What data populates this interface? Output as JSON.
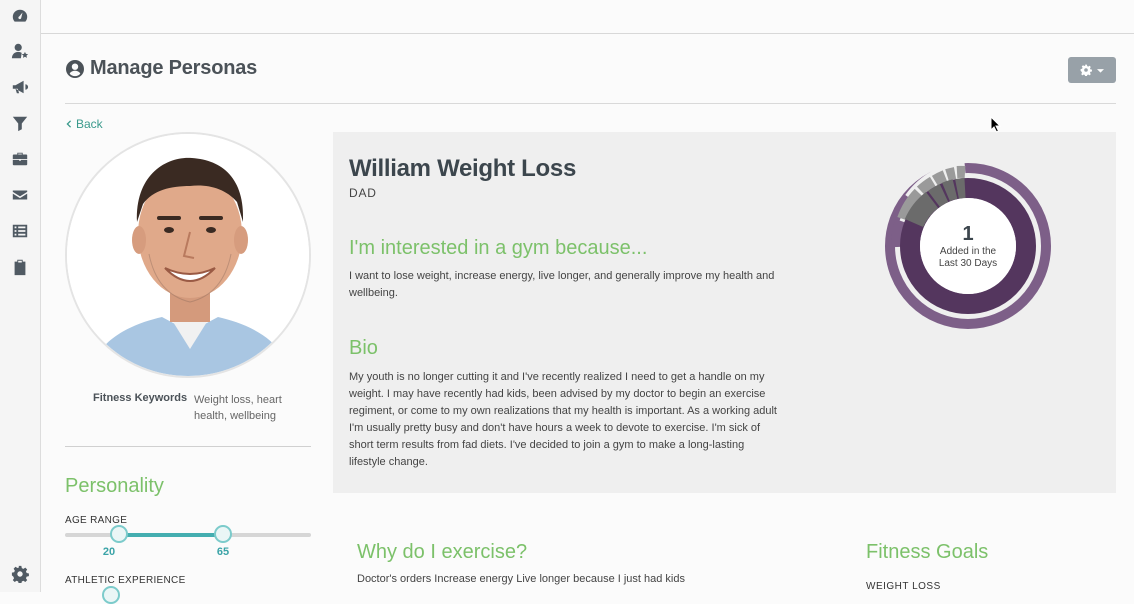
{
  "sidebar": {
    "items": [
      {
        "icon": "dashboard-icon"
      },
      {
        "icon": "user-star-icon"
      },
      {
        "icon": "megaphone-icon"
      },
      {
        "icon": "filter-icon"
      },
      {
        "icon": "briefcase-icon"
      },
      {
        "icon": "envelope-icon"
      },
      {
        "icon": "list-icon"
      },
      {
        "icon": "clipboard-icon"
      },
      {
        "icon": "gear-icon"
      }
    ]
  },
  "header": {
    "title": "Manage Personas",
    "icon": "user-circle-icon"
  },
  "back_label": "Back",
  "persona": {
    "name": "William Weight Loss",
    "role": "DAD",
    "interest_heading": "I'm interested in a gym because...",
    "interest_text": "I want to lose weight, increase energy, live longer, and generally improve my health and wellbeing.",
    "bio_heading": "Bio",
    "bio_text": "My youth is no longer cutting it and I've recently realized I need to get a handle on my weight. I may have recently had kids, been advised by my doctor to begin an exercise regiment, or come to my own realizations that my health is important. As a working adult I'm usually pretty busy and don't have hours a week to devote to exercise. I'm sick of short term results from fad diets. I've decided to join a gym to make a long-lasting lifestyle change."
  },
  "keywords": {
    "label": "Fitness Keywords",
    "value": "Weight loss, heart health, wellbeing"
  },
  "personality": {
    "title": "Personality",
    "age_range": {
      "label": "AGE RANGE",
      "min_value": "20",
      "max_value": "65",
      "min_frac": 0.2,
      "max_frac": 0.65
    },
    "athletic_label": "ATHLETIC EXPERIENCE"
  },
  "stats": {
    "count": "1",
    "caption_line1": "Added in the",
    "caption_line2": "Last 30 Days",
    "colors": {
      "main": "#54365e",
      "outer": "#7d5f88",
      "gray": "#6b6b6b"
    }
  },
  "why": {
    "heading": "Why do I exercise?",
    "text": "Doctor's orders Increase energy Live longer because I just had kids"
  },
  "goals": {
    "heading": "Fitness Goals",
    "first_item": "WEIGHT LOSS"
  },
  "colors": {
    "accent_green": "#7cc16a",
    "teal": "#44aeb0"
  }
}
